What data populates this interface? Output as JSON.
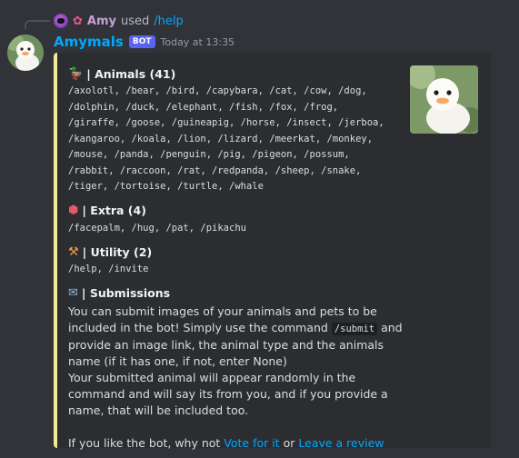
{
  "reply": {
    "user_icon": "purple-cat-avatar",
    "flower_icon": "hibiscus-icon",
    "name": "Amy",
    "used": "used",
    "command": "/help"
  },
  "message": {
    "username": "Amymals",
    "bot_tag": "BOT",
    "timestamp": "Today at 13:35",
    "avatar": "white-duckling-avatar"
  },
  "embed": {
    "accent_color": "#f0eb9a",
    "thumbnail": "white-duckling-image",
    "fields": {
      "animals": {
        "icon": "duck-icon",
        "title": "| Animals (41)",
        "commands": "/axolotl, /bear, /bird, /capybara, /cat, /cow, /dog, /dolphin, /duck, /elephant, /fish, /fox, /frog, /giraffe, /goose, /guineapig, /horse, /insect, /jerboa, /kangaroo, /koala, /lion, /lizard, /meerkat, /monkey, /mouse, /panda, /penguin, /pig, /pigeon, /possum, /rabbit, /raccoon, /rat, /redpanda, /sheep, /snake, /tiger, /tortoise, /turtle, /whale"
      },
      "extra": {
        "icon": "die-icon",
        "title": "| Extra (4)",
        "commands": "/facepalm, /hug, /pat, /pikachu"
      },
      "utility": {
        "icon": "hammer-and-pick-icon",
        "title": "| Utility (2)",
        "commands": "/help, /invite"
      },
      "submissions": {
        "icon": "mailbox-icon",
        "title": "| Submissions",
        "text_1": "You can submit images of your animals and pets to be included in the bot! Simply use the command",
        "command": "/submit",
        "text_2": "and provide an image link, the animal type and the animals name (if it has one, if not, enter None)",
        "text_3": "Your submitted animal will appear randomly in the command and will say its from you, and if you provide a name, that will be included too.",
        "footer_text": "If you like the bot, why not",
        "vote_link": "Vote for it",
        "or": "or",
        "review_link": "Leave a review"
      }
    }
  }
}
